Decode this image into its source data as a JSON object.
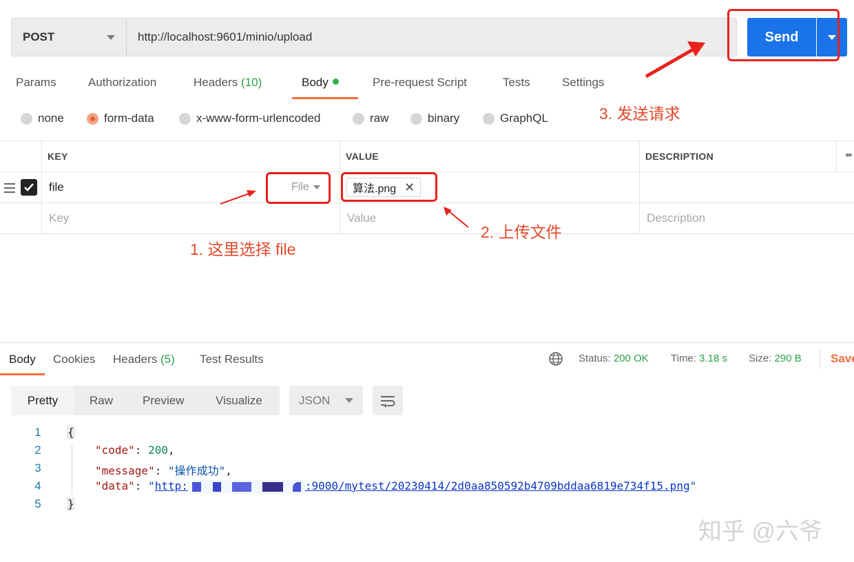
{
  "request": {
    "method": "POST",
    "url": "http://localhost:9601/minio/upload",
    "send_label": "Send"
  },
  "request_tabs": [
    {
      "label": "Params"
    },
    {
      "label": "Authorization"
    },
    {
      "label": "Headers",
      "count": "(10)"
    },
    {
      "label": "Body"
    },
    {
      "label": "Pre-request Script"
    },
    {
      "label": "Tests"
    },
    {
      "label": "Settings"
    }
  ],
  "body_types": [
    {
      "label": "none",
      "checked": false
    },
    {
      "label": "form-data",
      "checked": true
    },
    {
      "label": "x-www-form-urlencoded",
      "checked": false
    },
    {
      "label": "raw",
      "checked": false
    },
    {
      "label": "binary",
      "checked": false
    },
    {
      "label": "GraphQL",
      "checked": false
    }
  ],
  "form_table": {
    "headers": {
      "key": "KEY",
      "value": "VALUE",
      "description": "DESCRIPTION"
    },
    "row": {
      "key": "file",
      "type": "File",
      "file_name": "算法.png"
    },
    "placeholders": {
      "key": "Key",
      "value": "Value",
      "description": "Description"
    }
  },
  "annotations": {
    "step1": "1. 这里选择 file",
    "step2": "2. 上传文件",
    "step3": "3. 发送请求",
    "color": "#e8211d"
  },
  "response_tabs": [
    {
      "label": "Body"
    },
    {
      "label": "Cookies"
    },
    {
      "label": "Headers",
      "count": "(5)"
    },
    {
      "label": "Test Results"
    }
  ],
  "status": {
    "status_label": "Status:",
    "status_value": "200 OK",
    "time_label": "Time:",
    "time_value": "3.18 s",
    "size_label": "Size:",
    "size_value": "290 B",
    "save_label": "Save"
  },
  "view_modes": [
    "Pretty",
    "Raw",
    "Preview",
    "Visualize"
  ],
  "format": "JSON",
  "code": {
    "line_numbers": [
      "1",
      "2",
      "3",
      "4",
      "5"
    ],
    "open_brace": "{",
    "close_brace": "}",
    "code_key": "\"code\"",
    "code_value": "200",
    "message_key": "\"message\"",
    "message_value": "\"操作成功\"",
    "data_key": "\"data\"",
    "data_url_start": "http:",
    "data_url_end": ":9000/mytest/20230414/2d0aa850592b4709bddaa6819e734f15.png",
    "quote": "\""
  },
  "watermark": "知乎 @六爷",
  "colors": {
    "accent": "#f26b3a",
    "send": "#1a73e8",
    "success": "#2e9c4a"
  }
}
